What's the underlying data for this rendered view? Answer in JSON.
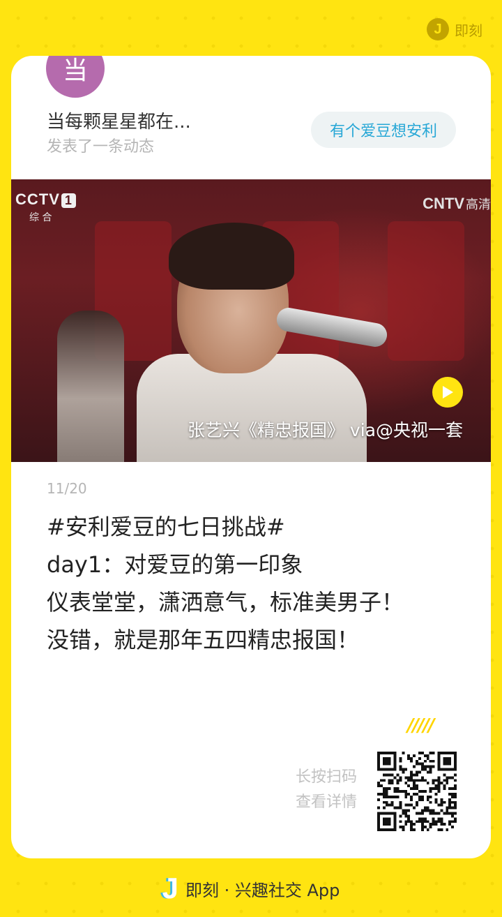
{
  "top_brand": {
    "logo_letter": "J",
    "label": "即刻"
  },
  "user": {
    "avatar_char": "当",
    "name": "当每颗星星都在...",
    "action": "发表了一条动态",
    "avatar_color": "#b56bad"
  },
  "topic": {
    "label": "有个爱豆想安利"
  },
  "media": {
    "channel_logo": "CCTV",
    "channel_number": "1",
    "channel_sub": "综 合",
    "hd_logo": "CNTV",
    "hd_sub": "高清",
    "caption": "张艺兴《精忠报国》 via@央视一套",
    "play_icon": "play-icon"
  },
  "post": {
    "date": "11/20",
    "lines": [
      "#安利爱豆的七日挑战#",
      "day1：对爱豆的第一印象",
      "仪表堂堂，潇洒意气，标准美男子！",
      "没错，就是那年五四精忠报国！"
    ]
  },
  "share": {
    "stripes": "/////",
    "hint_line1": "长按扫码",
    "hint_line2": "查看详情"
  },
  "footer": {
    "logo_letter": "J",
    "label": "即刻 · 兴趣社交 App"
  },
  "colors": {
    "background": "#ffe411",
    "accent_blue": "#27a7d6",
    "text_dark": "#222222",
    "text_muted": "#b5b5b5"
  }
}
